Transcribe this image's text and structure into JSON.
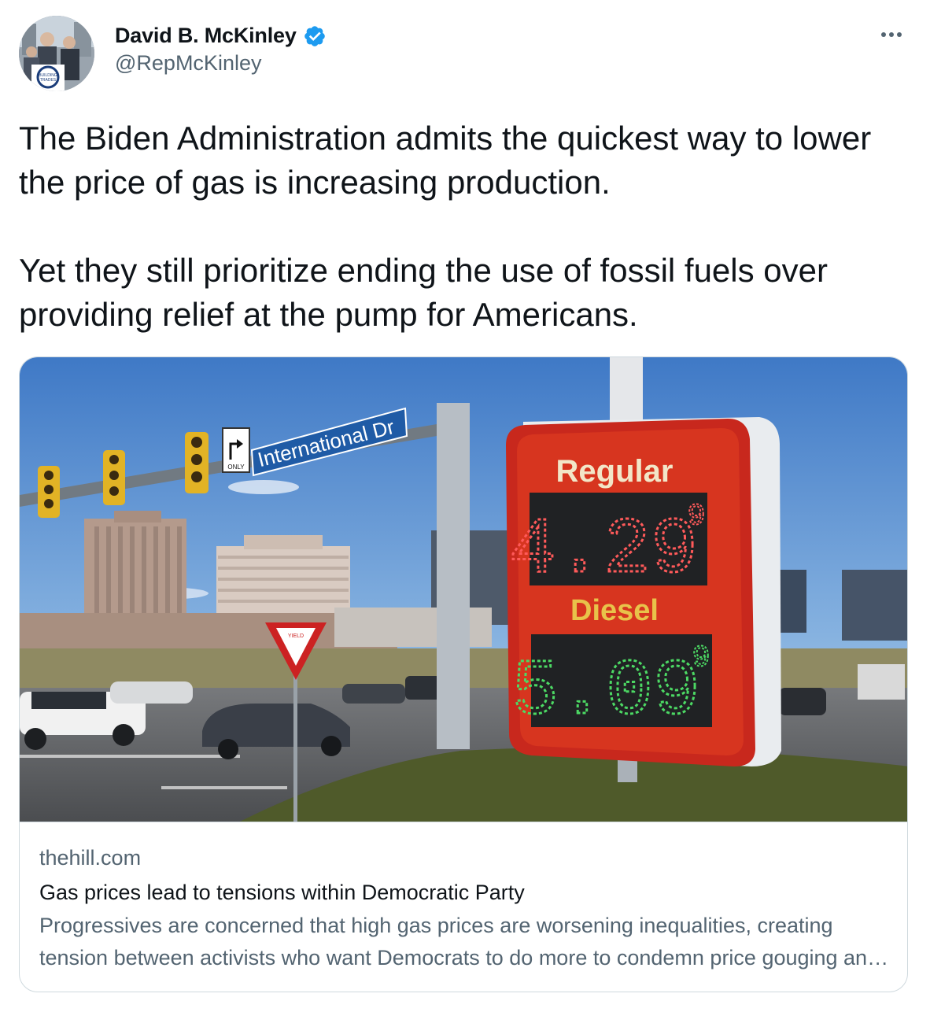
{
  "author": {
    "display_name": "David B. McKinley",
    "handle": "@RepMcKinley",
    "avatar_text": "BUILDING TRADES CAUCUS"
  },
  "tweet": {
    "paragraphs": [
      "The Biden Administration admits the quickest way to lower the price of gas is increasing production.",
      "Yet they still prioritize ending the use of fossil fuels over providing relief at the pump for Americans."
    ]
  },
  "card": {
    "image": {
      "street_sign": "International Dr",
      "turn_sign": "ONLY",
      "yield_sign": "YIELD",
      "price_sign": {
        "regular_label": "Regular",
        "regular_price": "4.29",
        "regular_tenth": "9",
        "diesel_label": "Diesel",
        "diesel_price": "5.09",
        "diesel_tenth": "9"
      }
    },
    "domain": "thehill.com",
    "title": "Gas prices lead to tensions within Democratic Party",
    "description": "Progressives are concerned that high gas prices are worsening inequalities, creating tension between activists who want Democrats to do more to condemn price gouging and moderates who worry"
  },
  "colors": {
    "verified": "#1d9bf0",
    "secondary_text": "#536471",
    "border": "#cfd9de",
    "sign_red": "#c8281d",
    "led_red": "#ff5a5a",
    "led_green": "#4cd964",
    "label_yellow": "#e8c34a"
  },
  "icons": [
    "verified-badge-icon",
    "more-icon"
  ]
}
